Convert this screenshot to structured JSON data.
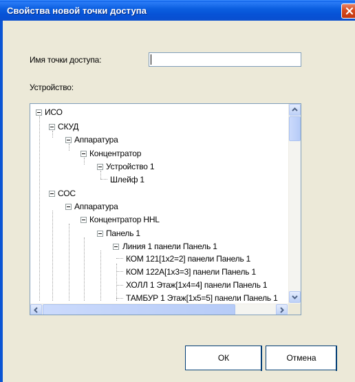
{
  "dialog": {
    "title": "Свойства новой точки доступа",
    "name_label": "Имя точки доступа:",
    "name_value": "",
    "device_label": "Устройство:"
  },
  "tree": {
    "nodes": [
      {
        "label": "ИСО",
        "expanded": true
      },
      {
        "label": "СКУД",
        "expanded": true
      },
      {
        "label": "Аппаратура",
        "expanded": true
      },
      {
        "label": "Концентратор",
        "expanded": true
      },
      {
        "label": "Устройство 1",
        "expanded": true
      },
      {
        "label": "Шлейф 1",
        "expanded": false
      },
      {
        "label": "СОС",
        "expanded": true
      },
      {
        "label": "Аппаратура",
        "expanded": true
      },
      {
        "label": "Концентратор HHL",
        "expanded": true
      },
      {
        "label": "Панель 1",
        "expanded": true
      },
      {
        "label": "Линия 1 панели Панель 1",
        "expanded": true
      },
      {
        "label": "КОМ 121[1x2=2] панели Панель 1",
        "expanded": false
      },
      {
        "label": "КОМ 122А[1x3=3] панели Панель 1",
        "expanded": false
      },
      {
        "label": "ХОЛЛ 1 Этаж[1x4=4] панели Панель 1",
        "expanded": false
      },
      {
        "label": "ТАМБУР 1 Этаж[1x5=5] панели Панель 1",
        "expanded": false
      }
    ]
  },
  "buttons": {
    "ok": "ОК",
    "cancel": "Отмена"
  },
  "icons": {
    "close": "close-icon",
    "scroll_up": "scroll-up-arrow-icon",
    "scroll_down": "scroll-down-arrow-icon",
    "scroll_left": "scroll-left-arrow-icon",
    "scroll_right": "scroll-right-arrow-icon"
  }
}
